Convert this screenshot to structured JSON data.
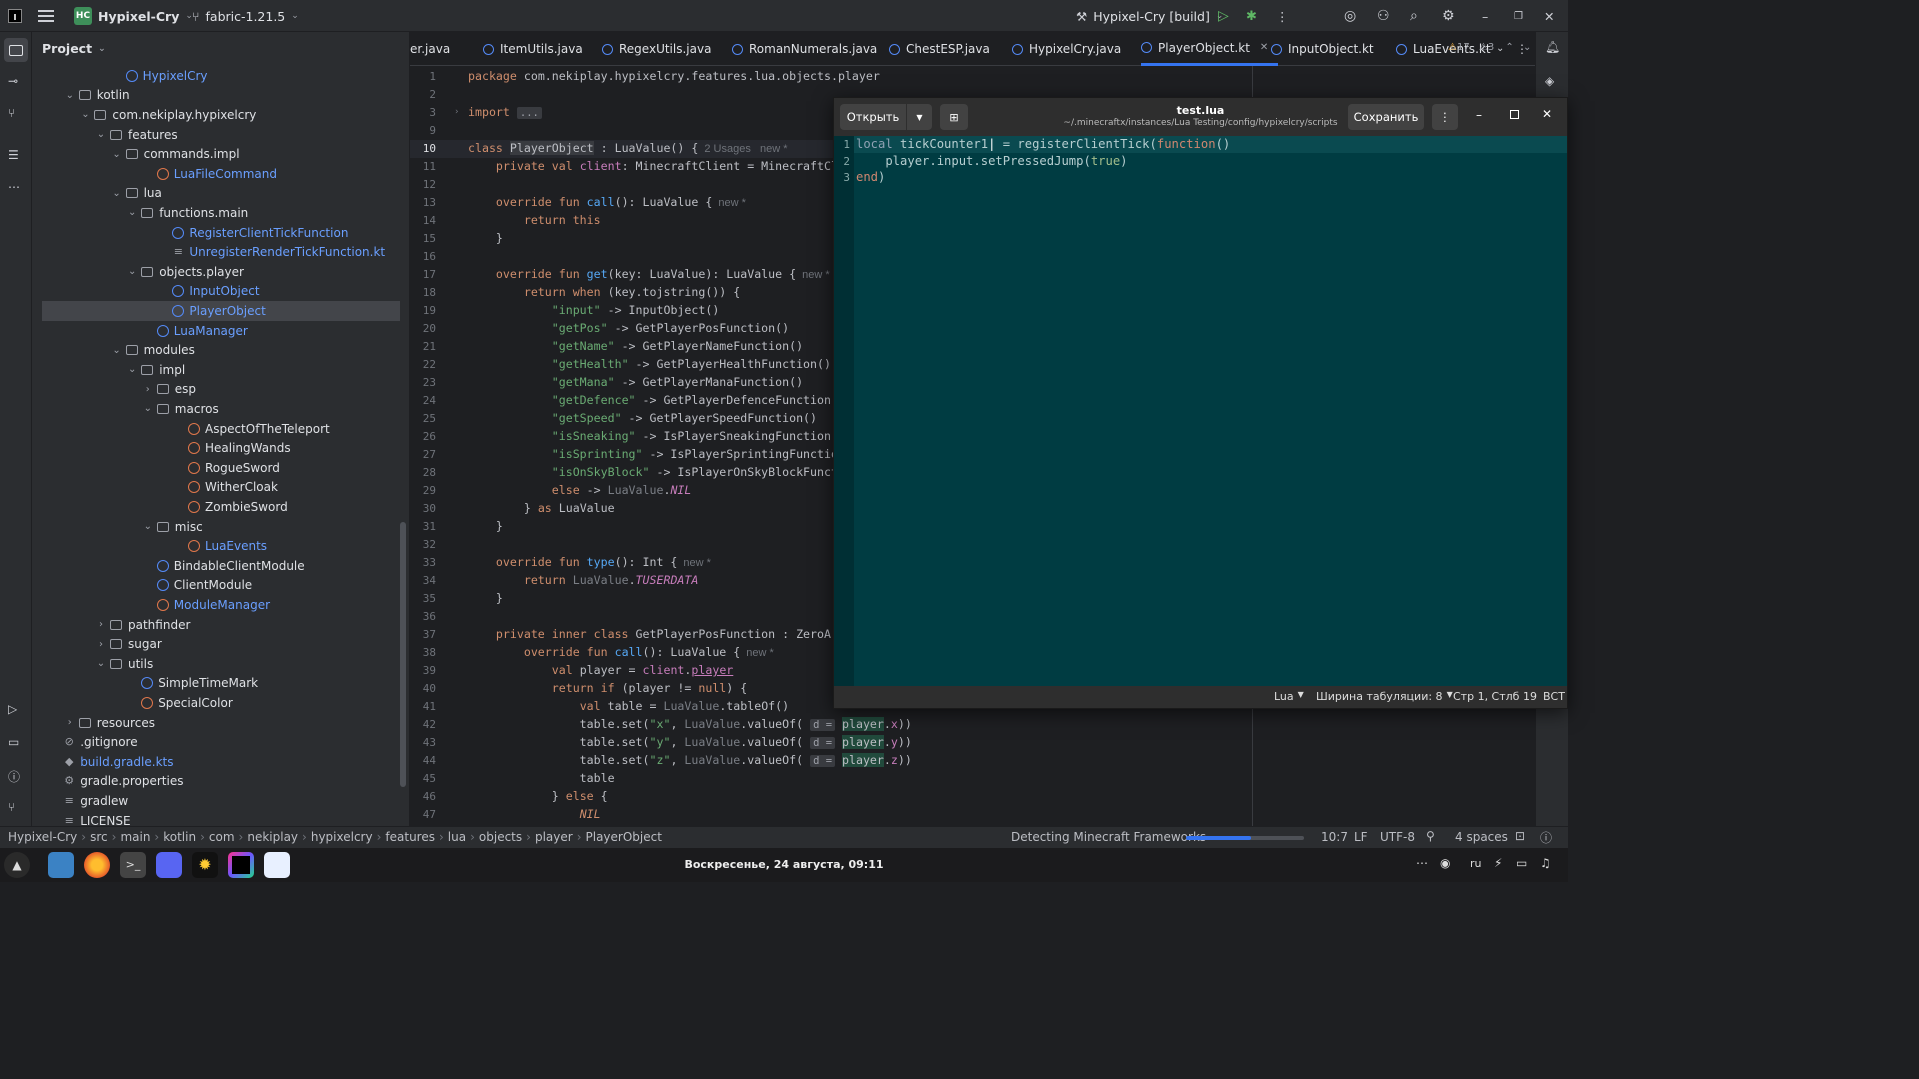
{
  "titlebar": {
    "project_badge": "HC",
    "project_name": "Hypixel-Cry",
    "branch": "fabric-1.21.5",
    "run_config": "Hypixel-Cry [build]"
  },
  "project_panel": {
    "title": "Project",
    "tree": [
      {
        "label": "HypixelCry",
        "type": "class",
        "color": "blue",
        "indent": 6,
        "arrow": ""
      },
      {
        "label": "kotlin",
        "type": "folder",
        "indent": 3,
        "arrow": "v"
      },
      {
        "label": "com.nekiplay.hypixelcry",
        "type": "folder",
        "indent": 4,
        "arrow": "v"
      },
      {
        "label": "features",
        "type": "folder",
        "indent": 5,
        "arrow": "v"
      },
      {
        "label": "commands.impl",
        "type": "folder",
        "indent": 6,
        "arrow": "v"
      },
      {
        "label": "LuaFileCommand",
        "type": "kclass",
        "color": "blue",
        "indent": 8,
        "arrow": ""
      },
      {
        "label": "lua",
        "type": "folder",
        "indent": 6,
        "arrow": "v"
      },
      {
        "label": "functions.main",
        "type": "folder",
        "indent": 7,
        "arrow": "v"
      },
      {
        "label": "RegisterClientTickFunction",
        "type": "class",
        "color": "blue",
        "indent": 9,
        "arrow": ""
      },
      {
        "label": "UnregisterRenderTickFunction.kt",
        "type": "file",
        "color": "blue",
        "indent": 9,
        "arrow": ""
      },
      {
        "label": "objects.player",
        "type": "folder",
        "indent": 7,
        "arrow": "v"
      },
      {
        "label": "InputObject",
        "type": "class",
        "color": "blue",
        "indent": 9,
        "arrow": ""
      },
      {
        "label": "PlayerObject",
        "type": "class",
        "color": "blue",
        "indent": 9,
        "arrow": "",
        "selected": true
      },
      {
        "label": "LuaManager",
        "type": "class",
        "color": "blue",
        "indent": 8,
        "arrow": ""
      },
      {
        "label": "modules",
        "type": "folder",
        "indent": 6,
        "arrow": "v"
      },
      {
        "label": "impl",
        "type": "folder",
        "indent": 7,
        "arrow": "v"
      },
      {
        "label": "esp",
        "type": "folder",
        "indent": 8,
        "arrow": ">"
      },
      {
        "label": "macros",
        "type": "folder",
        "indent": 8,
        "arrow": "v"
      },
      {
        "label": "AspectOfTheTeleport",
        "type": "kclass",
        "indent": 10,
        "arrow": ""
      },
      {
        "label": "HealingWands",
        "type": "kclass",
        "indent": 10,
        "arrow": ""
      },
      {
        "label": "RogueSword",
        "type": "kclass",
        "indent": 10,
        "arrow": ""
      },
      {
        "label": "WitherCloak",
        "type": "kclass",
        "indent": 10,
        "arrow": ""
      },
      {
        "label": "ZombieSword",
        "type": "kclass",
        "indent": 10,
        "arrow": ""
      },
      {
        "label": "misc",
        "type": "folder",
        "indent": 8,
        "arrow": "v"
      },
      {
        "label": "LuaEvents",
        "type": "kclass",
        "color": "blue",
        "indent": 10,
        "arrow": ""
      },
      {
        "label": "BindableClientModule",
        "type": "class",
        "indent": 8,
        "arrow": ""
      },
      {
        "label": "ClientModule",
        "type": "class",
        "indent": 8,
        "arrow": ""
      },
      {
        "label": "ModuleManager",
        "type": "kclass",
        "color": "blue",
        "indent": 8,
        "arrow": ""
      },
      {
        "label": "pathfinder",
        "type": "folder",
        "indent": 5,
        "arrow": ">"
      },
      {
        "label": "sugar",
        "type": "folder",
        "indent": 5,
        "arrow": ">"
      },
      {
        "label": "utils",
        "type": "folder",
        "indent": 5,
        "arrow": "v"
      },
      {
        "label": "SimpleTimeMark",
        "type": "class",
        "indent": 7,
        "arrow": ""
      },
      {
        "label": "SpecialColor",
        "type": "kclass",
        "indent": 7,
        "arrow": ""
      },
      {
        "label": "resources",
        "type": "folder",
        "indent": 3,
        "arrow": ">"
      },
      {
        "label": ".gitignore",
        "type": "ignore",
        "indent": 2,
        "arrow": ""
      },
      {
        "label": "build.gradle.kts",
        "type": "gradle",
        "color": "blue",
        "indent": 2,
        "arrow": ""
      },
      {
        "label": "gradle.properties",
        "type": "gear",
        "indent": 2,
        "arrow": ""
      },
      {
        "label": "gradlew",
        "type": "file",
        "indent": 2,
        "arrow": ""
      },
      {
        "label": "LICENSE",
        "type": "text",
        "indent": 2,
        "arrow": ""
      }
    ]
  },
  "tabs": [
    {
      "label": "er.java"
    },
    {
      "label": "ItemUtils.java"
    },
    {
      "label": "RegexUtils.java"
    },
    {
      "label": "RomanNumerals.java"
    },
    {
      "label": "ChestESP.java"
    },
    {
      "label": "HypixelCry.java"
    },
    {
      "label": "PlayerObject.kt",
      "active": true
    },
    {
      "label": "InputObject.kt"
    },
    {
      "label": "LuaEvents.kt"
    }
  ],
  "inspections": {
    "warnings": "17",
    "weak": "3"
  },
  "editor_lines": [
    {
      "n": "1",
      "html": "<span class='kw'>package</span> com.nekiplay.hypixelcry.features.lua.objects.player"
    },
    {
      "n": "2",
      "html": ""
    },
    {
      "n": "3",
      "html": "<span class='kw'>import</span> <span class='inl'>...</span>"
    },
    {
      "n": "9",
      "html": ""
    },
    {
      "n": "10",
      "html": "<span class='kw'>class</span> <span style='background:#393b40'>PlayerObject</span> : LuaValue() {<span class='hint'>2 Usages   new *</span>"
    },
    {
      "n": "11",
      "html": "    <span class='kw'>private val</span> <span class='prop'>client</span>: MinecraftClient = MinecraftClien"
    },
    {
      "n": "12",
      "html": ""
    },
    {
      "n": "13",
      "html": "    <span class='kw'>override fun</span> <span class='fn'>call</span>(): LuaValue {<span class='hint'>new *</span>"
    },
    {
      "n": "14",
      "html": "        <span class='kw'>return this</span>"
    },
    {
      "n": "15",
      "html": "    }"
    },
    {
      "n": "16",
      "html": ""
    },
    {
      "n": "17",
      "html": "    <span class='kw'>override fun</span> <span class='fn'>get</span>(key: LuaValue): LuaValue {<span class='hint'>new *</span>"
    },
    {
      "n": "18",
      "html": "        <span class='kw'>return when</span> (key.tojstring()) {"
    },
    {
      "n": "19",
      "html": "            <span class='str'>\"input\"</span> -> InputObject()"
    },
    {
      "n": "20",
      "html": "            <span class='str'>\"getPos\"</span> -> GetPlayerPosFunction()"
    },
    {
      "n": "21",
      "html": "            <span class='str'>\"getName\"</span> -> GetPlayerNameFunction()"
    },
    {
      "n": "22",
      "html": "            <span class='str'>\"getHealth\"</span> -> GetPlayerHealthFunction()"
    },
    {
      "n": "23",
      "html": "            <span class='str'>\"getMana\"</span> -> GetPlayerManaFunction()"
    },
    {
      "n": "24",
      "html": "            <span class='str'>\"getDefence\"</span> -> GetPlayerDefenceFunction()"
    },
    {
      "n": "25",
      "html": "            <span class='str'>\"getSpeed\"</span> -> GetPlayerSpeedFunction()"
    },
    {
      "n": "26",
      "html": "            <span class='str'>\"isSneaking\"</span> -> IsPlayerSneakingFunction()"
    },
    {
      "n": "27",
      "html": "            <span class='str'>\"isSprinting\"</span> -> IsPlayerSprintingFunction()"
    },
    {
      "n": "28",
      "html": "            <span class='str'>\"isOnSkyBlock\"</span> -> IsPlayerOnSkyBlockFunction"
    },
    {
      "n": "29",
      "html": "            <span class='kw'>else</span> -> <span class='gr'>LuaValue</span>.<span class='it'>NIL</span>"
    },
    {
      "n": "30",
      "html": "        } <span class='kw'>as</span> LuaValue"
    },
    {
      "n": "31",
      "html": "    }"
    },
    {
      "n": "32",
      "html": ""
    },
    {
      "n": "33",
      "html": "    <span class='kw'>override fun</span> <span class='fn'>type</span>(): Int {<span class='hint'>new *</span>"
    },
    {
      "n": "34",
      "html": "        <span class='kw'>return</span> <span class='gr'>LuaValue</span>.<span class='it'>TUSERDATA</span>"
    },
    {
      "n": "35",
      "html": "    }"
    },
    {
      "n": "36",
      "html": ""
    },
    {
      "n": "37",
      "html": "    <span class='kw'>private inner class</span> GetPlayerPosFunction : ZeroArgFu"
    },
    {
      "n": "38",
      "html": "        <span class='kw'>override fun</span> <span class='fn'>call</span>(): LuaValue {<span class='hint'>new *</span>"
    },
    {
      "n": "39",
      "html": "            <span class='kw'>val</span> player = <span class='prop'>client</span>.<span class='prop' style='text-decoration:underline'>player</span>"
    },
    {
      "n": "40",
      "html": "            <span class='kw'>return if</span> (player != <span class='kw'>null</span>) {"
    },
    {
      "n": "41",
      "html": "                <span class='kw'>val</span> table = <span class='gr'>LuaValue</span>.tableOf()"
    },
    {
      "n": "42",
      "html": "                table.set(<span class='str'>\"x\"</span>, <span class='gr'>LuaValue</span>.valueOf( <span class='inl'>d =</span> <span style='background:#214a3c'>player</span>.<span class='prop'>x</span>))"
    },
    {
      "n": "43",
      "html": "                table.set(<span class='str'>\"y\"</span>, <span class='gr'>LuaValue</span>.valueOf( <span class='inl'>d =</span> <span style='background:#214a3c'>player</span>.<span class='prop'>y</span>))"
    },
    {
      "n": "44",
      "html": "                table.set(<span class='str'>\"z\"</span>, <span class='gr'>LuaValue</span>.valueOf( <span class='inl'>d =</span> <span style='background:#214a3c'>player</span>.<span class='prop'>z</span>))"
    },
    {
      "n": "45",
      "html": "                table"
    },
    {
      "n": "46",
      "html": "            } <span class='kw'>else</span> {"
    },
    {
      "n": "47",
      "html": "                <span class='it' style='color:#cf8e6d'>NIL</span>"
    }
  ],
  "lua_window": {
    "open_label": "Открыть",
    "title": "test.lua",
    "path": "~/.minecraftx/instances/Lua Testing/config/hypixelcry/scripts",
    "save_label": "Сохранить",
    "lines": [
      {
        "n": "1",
        "html": "<span style='color:#8fa1b3'>local</span> tickCounter1<span style='color:#fff'>|</span> = registerClientTick(<span style='color:#d08770'>function</span>()"
      },
      {
        "n": "2",
        "html": "    player.input.setPressedJump(<span style='color:#a3be8c'>true</span>)"
      },
      {
        "n": "3",
        "html": "<span style='color:#d08770'>end</span>)"
      }
    ],
    "status": {
      "language": "Lua",
      "tab_width": "Ширина табуляции: 8",
      "position": "Стр 1, Стлб 19",
      "mode": "ВСТ"
    }
  },
  "statusbar": {
    "breadcrumbs": [
      "Hypixel-Cry",
      "src",
      "main",
      "kotlin",
      "com",
      "nekiplay",
      "hypixelcry",
      "features",
      "lua",
      "objects",
      "player",
      "PlayerObject"
    ],
    "task": "Detecting Minecraft Frameworks",
    "progress": 0.55,
    "caret": "10:7",
    "line_sep": "LF",
    "encoding": "UTF-8",
    "indent": "4 spaces"
  },
  "taskbar": {
    "clock": "Воскресенье, 24 августа, 09:11",
    "lang": "ru"
  },
  "colors": {
    "accent": "#3574f0",
    "lua_bg": "#003c42"
  }
}
